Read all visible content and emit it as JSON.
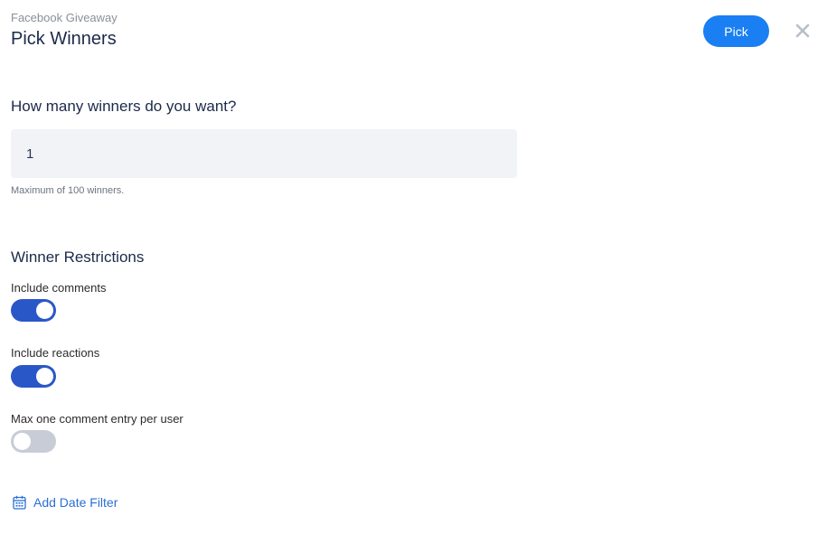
{
  "header": {
    "subtitle": "Facebook Giveaway",
    "title": "Pick Winners",
    "pick_label": "Pick"
  },
  "winners": {
    "question": "How many winners do you want?",
    "value": "1",
    "hint": "Maximum of 100 winners."
  },
  "restrictions": {
    "title": "Winner Restrictions",
    "items": [
      {
        "label": "Include comments",
        "enabled": true
      },
      {
        "label": "Include reactions",
        "enabled": true
      },
      {
        "label": "Max one comment entry per user",
        "enabled": false
      }
    ]
  },
  "date_filter": {
    "label": "Add Date Filter",
    "icon": "calendar-icon"
  },
  "colors": {
    "primary": "#1a7ff2",
    "toggle_on": "#2a57c8",
    "toggle_off": "#c8ccd6",
    "link": "#2a6fd6"
  }
}
